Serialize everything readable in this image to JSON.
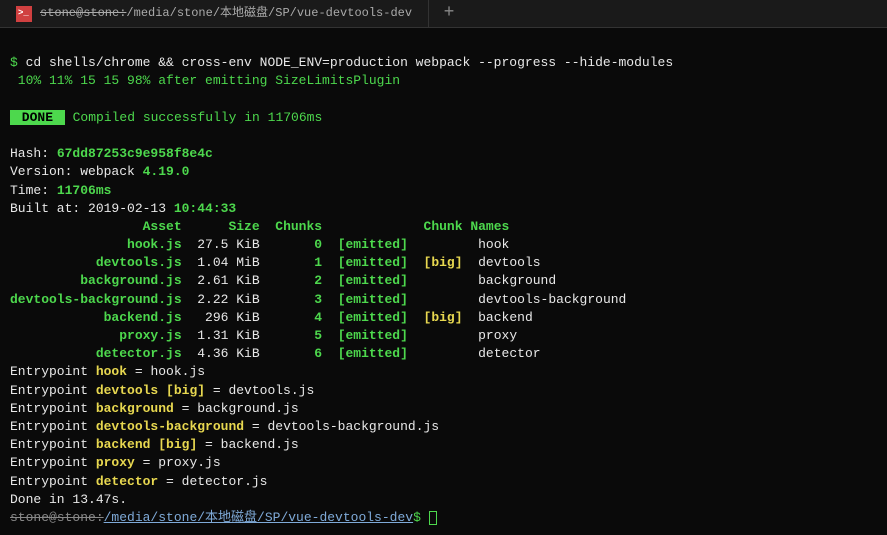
{
  "titlebar": {
    "tab_title_struck": "stone@stone:",
    "tab_title": "/media/stone/本地磁盘/SP/vue-devtools-dev",
    "new_tab": "+"
  },
  "term": {
    "cmd_prompt": "$ ",
    "cmd": "cd shells/chrome && cross-env NODE_ENV=production webpack --progress --hide-modules",
    "progress": " 10% 11% 15 15 98% after emitting SizeLimitsPlugin",
    "done_badge": " DONE ",
    "done_text": " Compiled successfully in 11706ms",
    "hash_label": "Hash: ",
    "hash": "67dd87253c9e958f8e4c",
    "version_label": "Version: webpack ",
    "version": "4.19.0",
    "time_label": "Time: ",
    "time": "11706ms",
    "built_label": "Built at: 2019-02-13 ",
    "built_time": "10:44:33",
    "header": {
      "asset": "Asset",
      "size": "Size",
      "chunks": "Chunks",
      "chunk_names": "Chunk Names"
    },
    "rows": [
      {
        "asset": "               hook.js",
        "size": "27.5 KiB",
        "chunk": "0",
        "emitted": "[emitted]",
        "big": "     ",
        "name": "hook"
      },
      {
        "asset": "           devtools.js",
        "size": "1.04 MiB",
        "chunk": "1",
        "emitted": "[emitted]",
        "big": "[big]",
        "name": "devtools"
      },
      {
        "asset": "         background.js",
        "size": "2.61 KiB",
        "chunk": "2",
        "emitted": "[emitted]",
        "big": "     ",
        "name": "background"
      },
      {
        "asset": "devtools-background.js",
        "size": "2.22 KiB",
        "chunk": "3",
        "emitted": "[emitted]",
        "big": "     ",
        "name": "devtools-background"
      },
      {
        "asset": "            backend.js",
        "size": " 296 KiB",
        "chunk": "4",
        "emitted": "[emitted]",
        "big": "[big]",
        "name": "backend"
      },
      {
        "asset": "              proxy.js",
        "size": "1.31 KiB",
        "chunk": "5",
        "emitted": "[emitted]",
        "big": "     ",
        "name": "proxy"
      },
      {
        "asset": "           detector.js",
        "size": "4.36 KiB",
        "chunk": "6",
        "emitted": "[emitted]",
        "big": "     ",
        "name": "detector"
      }
    ],
    "entrypoints": [
      {
        "prefix": "Entrypoint ",
        "name": "hook",
        "eq": " = hook.js"
      },
      {
        "prefix": "Entrypoint ",
        "name": "devtools [big]",
        "eq": " = devtools.js"
      },
      {
        "prefix": "Entrypoint ",
        "name": "background",
        "eq": " = background.js"
      },
      {
        "prefix": "Entrypoint ",
        "name": "devtools-background",
        "eq": " = devtools-background.js"
      },
      {
        "prefix": "Entrypoint ",
        "name": "backend [big]",
        "eq": " = backend.js"
      },
      {
        "prefix": "Entrypoint ",
        "name": "proxy",
        "eq": " = proxy.js"
      },
      {
        "prefix": "Entrypoint ",
        "name": "detector",
        "eq": " = detector.js"
      }
    ],
    "done_in": "Done in 13.47s.",
    "final_prompt_struck": "stone@stone:",
    "final_prompt_path": "/media/stone/本地磁盘/SP/vue-devtools-dev",
    "final_dollar": "$ "
  }
}
